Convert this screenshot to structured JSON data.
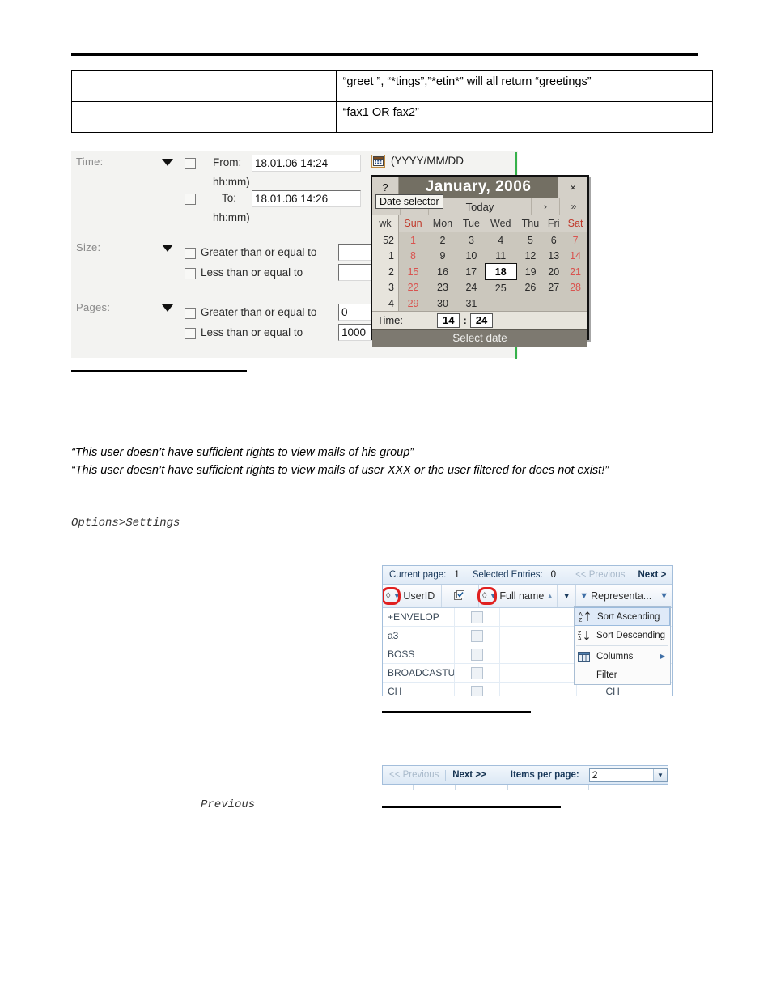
{
  "doc_table": {
    "rows": [
      {
        "left": "",
        "right": "“greet ”, “*tings”,”*etin*” will all return “greetings”"
      },
      {
        "left": "",
        "right": "“fax1 OR fax2”"
      }
    ]
  },
  "paragraphs": {
    "msg1": "“This user doesn’t have sufficient rights to view mails of his group”",
    "msg2": "“This user doesn’t have sufficient rights to view mails of user XXX or the user filtered for does not exist!”",
    "options_path": "Options>Settings",
    "previous_caption": "Previous"
  },
  "filter_panel": {
    "groups": [
      {
        "label": "Time:"
      },
      {
        "label": "Size:"
      },
      {
        "label": "Pages:"
      }
    ],
    "time": {
      "from_label": "From:",
      "from_value": "18.01.06 14:24",
      "from_hint": "hh:mm)",
      "to_label": "To:",
      "to_value": "18.01.06 14:26",
      "to_hint": "hh:mm)",
      "format_hint": "(YYYY/MM/DD",
      "calendar_icon": "calendar-icon"
    },
    "size": {
      "gte_label": "Greater than or equal to",
      "gte_value": "",
      "lte_label": "Less than or equal to",
      "lte_value": ""
    },
    "pages": {
      "gte_label": "Greater than or equal to",
      "gte_value": "0",
      "lte_label": "Less than or equal to",
      "lte_value": "1000"
    }
  },
  "date_selector": {
    "help": "?",
    "title": "January, 2006",
    "close": "×",
    "tooltip": "Date selector",
    "nav": {
      "prev_year": "«",
      "prev_month": "‹",
      "today": "Today",
      "next_month": "›",
      "next_year": "»"
    },
    "headers": [
      "wk",
      "Sun",
      "Mon",
      "Tue",
      "Wed",
      "Thu",
      "Fri",
      "Sat"
    ],
    "weeks": [
      {
        "wk": "52",
        "days": [
          "1",
          "2",
          "3",
          "4",
          "5",
          "6",
          "7"
        ]
      },
      {
        "wk": "1",
        "days": [
          "8",
          "9",
          "10",
          "11",
          "12",
          "13",
          "14"
        ]
      },
      {
        "wk": "2",
        "days": [
          "15",
          "16",
          "17",
          "18",
          "19",
          "20",
          "21"
        ]
      },
      {
        "wk": "3",
        "days": [
          "22",
          "23",
          "24",
          "25",
          "26",
          "27",
          "28"
        ]
      },
      {
        "wk": "4",
        "days": [
          "29",
          "30",
          "31",
          "",
          "",
          "",
          ""
        ]
      }
    ],
    "selected_day": "18",
    "time_label": "Time:",
    "hour": "14",
    "colon": ":",
    "minute": "24",
    "select_button": "Select date"
  },
  "grid": {
    "pager": {
      "current_page_label": "Current page:",
      "current_page_value": "1",
      "selected_entries_label": "Selected Entries:",
      "selected_entries_value": "0",
      "previous_label": "<< Previous",
      "next_label": "Next >"
    },
    "columns": [
      {
        "title": "UserID",
        "diamond": "◊",
        "funnel": "filter-icon",
        "sorted": false
      },
      {
        "title": "",
        "icon": "checkbox-columns-icon"
      },
      {
        "title": "Full name",
        "diamond": "◊",
        "funnel": "filter-icon",
        "sorted": true,
        "sort_glyph": "▲"
      },
      {
        "title": "",
        "icon": "dropdown-arrow-icon"
      },
      {
        "title": "Representa...",
        "funnel": "filter-icon"
      },
      {
        "title": "",
        "funnel": "filter-icon"
      }
    ],
    "rows": [
      {
        "userid": "+ENVELOP",
        "checked": false,
        "fullname": "",
        "representative": ""
      },
      {
        "userid": "a3",
        "checked": false,
        "fullname": "",
        "representative": ""
      },
      {
        "userid": "BOSS",
        "checked": false,
        "fullname": "",
        "representative": ""
      },
      {
        "userid": "BROADCASTU...",
        "checked": false,
        "fullname": "",
        "representative": ""
      },
      {
        "userid": "CH",
        "checked": false,
        "fullname": "",
        "representative": "CH"
      }
    ],
    "context_menu": {
      "items": [
        {
          "label": "Sort Ascending",
          "icon": "sort-ascending-icon",
          "highlighted": true,
          "submenu": false
        },
        {
          "label": "Sort Descending",
          "icon": "sort-descending-icon",
          "highlighted": false,
          "submenu": false
        },
        {
          "label": "Columns",
          "icon": "columns-icon",
          "highlighted": false,
          "submenu": true
        },
        {
          "label": "Filter",
          "icon": "",
          "highlighted": false,
          "submenu": false
        }
      ]
    }
  },
  "items_per_page_bar": {
    "previous_label": "<< Previous",
    "next_label": "Next >>",
    "items_per_page_label": "Items per page:",
    "items_per_page_value": "2"
  },
  "colors": {
    "annotation_red": "#e02020",
    "grid_accent": "#a3bedb",
    "calendar_title": "#736f63",
    "weekend_red": "#d9534f",
    "cursor_green": "#35b14a"
  }
}
